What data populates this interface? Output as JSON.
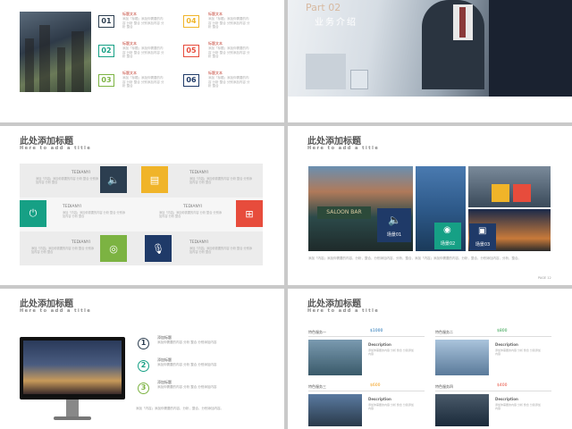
{
  "slide1": {
    "items": [
      {
        "num": "01",
        "label": "标题文本",
        "text": "添加「标题」添加你需要的内容 分析 整合 分别添加内容 分析 整合",
        "color": "#2c3e50"
      },
      {
        "num": "02",
        "label": "标题文本",
        "text": "添加「标题」添加你需要的内容 分析 整合 分别添加内容 分析 整合",
        "color": "#16a085"
      },
      {
        "num": "03",
        "label": "标题文本",
        "text": "添加「标题」添加你需要的内容 分析 整合 分别添加内容 分析 整合",
        "color": "#7cb342"
      },
      {
        "num": "04",
        "label": "标题文本",
        "text": "添加「标题」添加你需要的内容 分析 整合 分别添加内容 分析 整合",
        "color": "#f0b429"
      },
      {
        "num": "05",
        "label": "标题文本",
        "text": "添加「标题」添加你需要的内容 分析 整合 分别添加内容 分析 整合",
        "color": "#e74c3c"
      },
      {
        "num": "06",
        "label": "标题文本",
        "text": "添加「标题」添加你需要的内容 分析 整合 分别添加内容 分析 整合",
        "color": "#1f3a68"
      }
    ]
  },
  "slide2": {
    "part": "Part 02",
    "title": "业务介绍"
  },
  "slide3": {
    "title": "此处添加标题",
    "subtitle": "Here to add a title",
    "left_labels": [
      "TEDIANYI",
      "TEDIANYI",
      "TEDIANYI"
    ],
    "right_labels": [
      "TEDIANYI",
      "TEDIANYI",
      "TEDIANYI"
    ],
    "desc": "添加「内容」添加你需要的内容 分析 整合 分别添加内容 分析 整合"
  },
  "slide4": {
    "title": "此处添加标题",
    "subtitle": "Here to add a title",
    "scenes": [
      "场景01",
      "场景02",
      "场景03"
    ],
    "body": "添加「内容」添加你需要的内容，分析，整合，分别添加内容，分析，整合，添加「内容」添加你需要的内容，分析，整合，分别添加内容，分析，整合。",
    "page": "PAGE 12"
  },
  "slide5": {
    "title": "此处添加标题",
    "subtitle": "Here to add a title",
    "items": [
      {
        "n": "1",
        "head": "添加标题",
        "text": "添加你需要的内容 分析 整合 分别添加内容",
        "color": "#2c3e50"
      },
      {
        "n": "2",
        "head": "添加标题",
        "text": "添加你需要的内容 分析 整合 分别添加内容",
        "color": "#16a085"
      },
      {
        "n": "3",
        "head": "添加标题",
        "text": "添加你需要的内容 分析 整合 分别添加内容",
        "color": "#7cb342"
      }
    ],
    "footer": "添加「内容」添加你需要的内容，分析，整合，分别添加内容。"
  },
  "slide6": {
    "title": "此处添加标题",
    "subtitle": "Here to add a title",
    "cards": [
      {
        "name": "特色服务一",
        "price": "$1000",
        "price_color": "#1a6fb3",
        "desc_head": "Description",
        "desc": "添加你需要的内容 分析 整合 分别添加内容"
      },
      {
        "name": "特色服务二",
        "price": "$800",
        "price_color": "#2e9e4a",
        "desc_head": "Description",
        "desc": "添加你需要的内容 分析 整合 分别添加内容"
      },
      {
        "name": "特色服务三",
        "price": "$600",
        "price_color": "#f39c12",
        "desc_head": "Description",
        "desc": "添加你需要的内容 分析 整合 分别添加内容"
      },
      {
        "name": "特色服务四",
        "price": "$400",
        "price_color": "#e74c3c",
        "desc_head": "Description",
        "desc": "添加你需要的内容 分析 整合 分别添加内容"
      }
    ]
  }
}
